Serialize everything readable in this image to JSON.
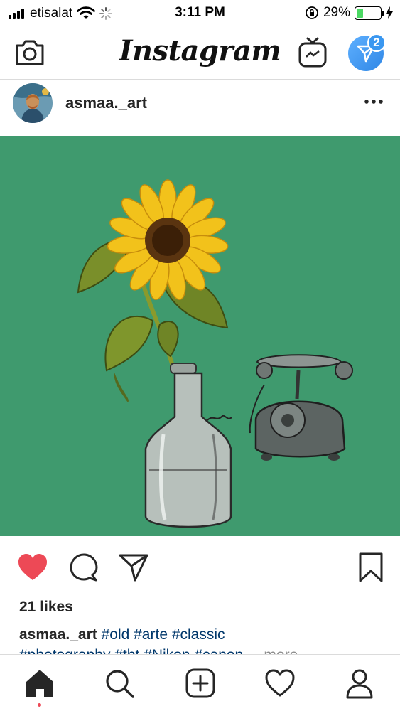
{
  "status_bar": {
    "carrier": "etisalat",
    "time": "3:11 PM",
    "battery_percent": "29%",
    "battery_level": 0.29,
    "signal_bars": 4,
    "icons": [
      "signal-bars-icon",
      "wifi-icon",
      "loading-spinner-icon",
      "orientation-lock-icon",
      "battery-icon",
      "charging-bolt-icon"
    ]
  },
  "top_nav": {
    "logo": "Instagram",
    "camera_icon": "camera-icon",
    "igtv_icon": "igtv-icon",
    "direct_icon": "direct-message-icon",
    "direct_badge": "2",
    "direct_color": "#3897f0"
  },
  "post": {
    "username": "asmaa._art",
    "more_icon": "more-options-icon",
    "image_background": "#3f9a6e",
    "image_subject": [
      "sunflower",
      "glass-vase",
      "vintage-telephone"
    ],
    "liked": true,
    "like_color": "#ed4956",
    "likes": "21 likes",
    "caption_user": "asmaa._art",
    "caption_hashtags": "#old #arte #classic",
    "caption_line2": "#photography #tbt #Nikon #canon",
    "caption_more": "... more"
  },
  "tab_bar": {
    "items": [
      "home-icon",
      "search-icon",
      "new-post-icon",
      "activity-heart-icon",
      "profile-icon"
    ],
    "active": "home-icon"
  }
}
